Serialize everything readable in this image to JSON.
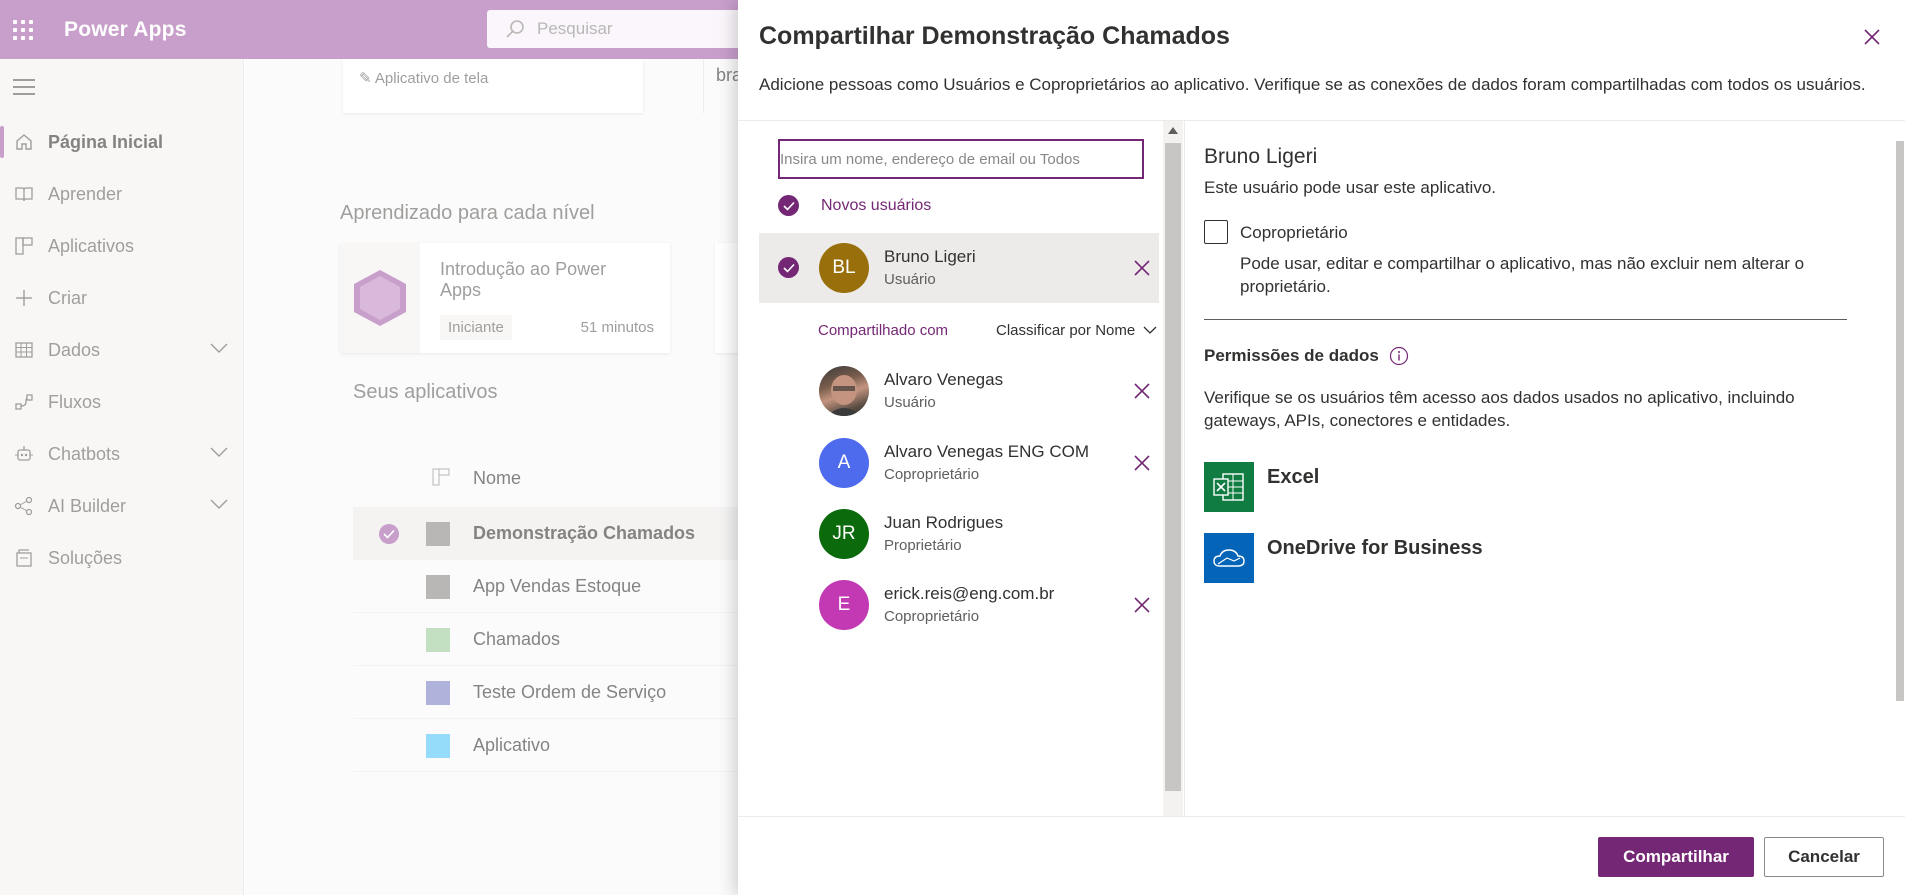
{
  "app": {
    "title": "Power Apps",
    "search_placeholder": "Pesquisar"
  },
  "sidebar": {
    "items": [
      {
        "label": "Página Inicial",
        "icon": "home-icon",
        "active": true
      },
      {
        "label": "Aprender",
        "icon": "book-icon"
      },
      {
        "label": "Aplicativos",
        "icon": "apps-icon"
      },
      {
        "label": "Criar",
        "icon": "plus-icon"
      },
      {
        "label": "Dados",
        "icon": "table-icon",
        "expandable": true
      },
      {
        "label": "Fluxos",
        "icon": "flow-icon"
      },
      {
        "label": "Chatbots",
        "icon": "bot-icon",
        "expandable": true
      },
      {
        "label": "AI Builder",
        "icon": "ai-icon",
        "expandable": true
      },
      {
        "label": "Soluções",
        "icon": "solutions-icon"
      }
    ]
  },
  "main": {
    "top_card_label": "Aplicativo de tela",
    "top_card2_text": "bra",
    "learning_title": "Aprendizado para cada nível",
    "learning_card": {
      "title": "Introdução ao Power Apps",
      "level": "Iniciante",
      "duration": "51 minutos"
    },
    "apps_title": "Seus aplicativos",
    "apps_column": "Nome",
    "apps": [
      {
        "name": "Demonstração Chamados",
        "selected": true,
        "color": "#8a8886"
      },
      {
        "name": "App Vendas Estoque",
        "color": "#8a8886"
      },
      {
        "name": "Chamados",
        "color": "#9ccc9c"
      },
      {
        "name": "Teste Ordem de Serviço",
        "color": "#7a7fc4"
      },
      {
        "name": "Aplicativo",
        "color": "#4fc3f7"
      }
    ]
  },
  "panel": {
    "title": "Compartilhar Demonstração Chamados",
    "description": "Adicione pessoas como Usuários e Coproprietários ao aplicativo. Verifique se as conexões de dados foram compartilhadas com todos os usuários.",
    "input_placeholder": "Insira um nome, endereço de email ou Todos",
    "new_users_label": "Novos usuários",
    "new_users": [
      {
        "initials": "BL",
        "name": "Bruno Ligeri",
        "role": "Usuário",
        "color": "#986f0b"
      }
    ],
    "shared_with_label": "Compartilhado com",
    "sort_label": "Classificar por Nome",
    "shared_users": [
      {
        "initials": "",
        "name": "Alvaro Venegas",
        "role": "Usuário",
        "photo": true,
        "removable": true
      },
      {
        "initials": "A",
        "name": "Alvaro Venegas ENG COM",
        "role": "Coproprietário",
        "color": "#4f6bed",
        "removable": true
      },
      {
        "initials": "JR",
        "name": "Juan Rodrigues",
        "role": "Proprietário",
        "color": "#0b6a0b",
        "removable": false
      },
      {
        "initials": "E",
        "name": "erick.reis@eng.com.br",
        "role": "Coproprietário",
        "color": "#c239b3",
        "removable": true
      }
    ],
    "detail": {
      "name": "Bruno Ligeri",
      "subtitle": "Este usuário pode usar este aplicativo.",
      "coowner_label": "Coproprietário",
      "coowner_desc": "Pode usar, editar e compartilhar o aplicativo, mas não excluir nem alterar o proprietário.",
      "permissions_title": "Permissões de dados",
      "permissions_desc": "Verifique se os usuários têm acesso aos dados usados no aplicativo, incluindo gateways, APIs, conectores e entidades.",
      "sources": [
        {
          "name": "Excel",
          "icon": "excel-icon",
          "color": "#107c41"
        },
        {
          "name": "OneDrive for Business",
          "icon": "onedrive-icon",
          "color": "#0364b8"
        }
      ]
    },
    "share_button": "Compartilhar",
    "cancel_button": "Cancelar"
  }
}
